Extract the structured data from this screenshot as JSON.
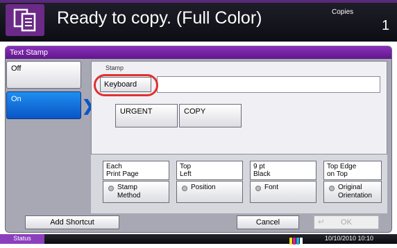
{
  "header": {
    "title": "Ready to copy. (Full Color)",
    "copies_label": "Copies",
    "copies_value": "1"
  },
  "panel": {
    "title": "Text Stamp"
  },
  "mode_buttons": {
    "off": "Off",
    "on": "On"
  },
  "stamp": {
    "label": "Stamp",
    "keyboard_button": "Keyboard",
    "field_value": ""
  },
  "presets": [
    {
      "label": "URGENT"
    },
    {
      "label": "COPY"
    }
  ],
  "options": [
    {
      "value_line1": "Each",
      "value_line2": "Print Page",
      "button_line1": "Stamp",
      "button_line2": "Method"
    },
    {
      "value_line1": "Top",
      "value_line2": "Left",
      "button_line1": "Position",
      "button_line2": ""
    },
    {
      "value_line1": "9 pt",
      "value_line2": "Black",
      "button_line1": "Font",
      "button_line2": ""
    },
    {
      "value_line1": "Top Edge",
      "value_line2": "on Top",
      "button_line1": "Original",
      "button_line2": "Orientation"
    }
  ],
  "footer": {
    "add_shortcut": "Add Shortcut",
    "cancel": "Cancel",
    "ok": "OK"
  },
  "status_bar": {
    "status": "Status",
    "datetime": "10/10/2010  10:10"
  },
  "colors": {
    "accent_purple": "#8c2fbd",
    "selected_blue": "#0a55c6",
    "highlight_red": "#e03030"
  }
}
